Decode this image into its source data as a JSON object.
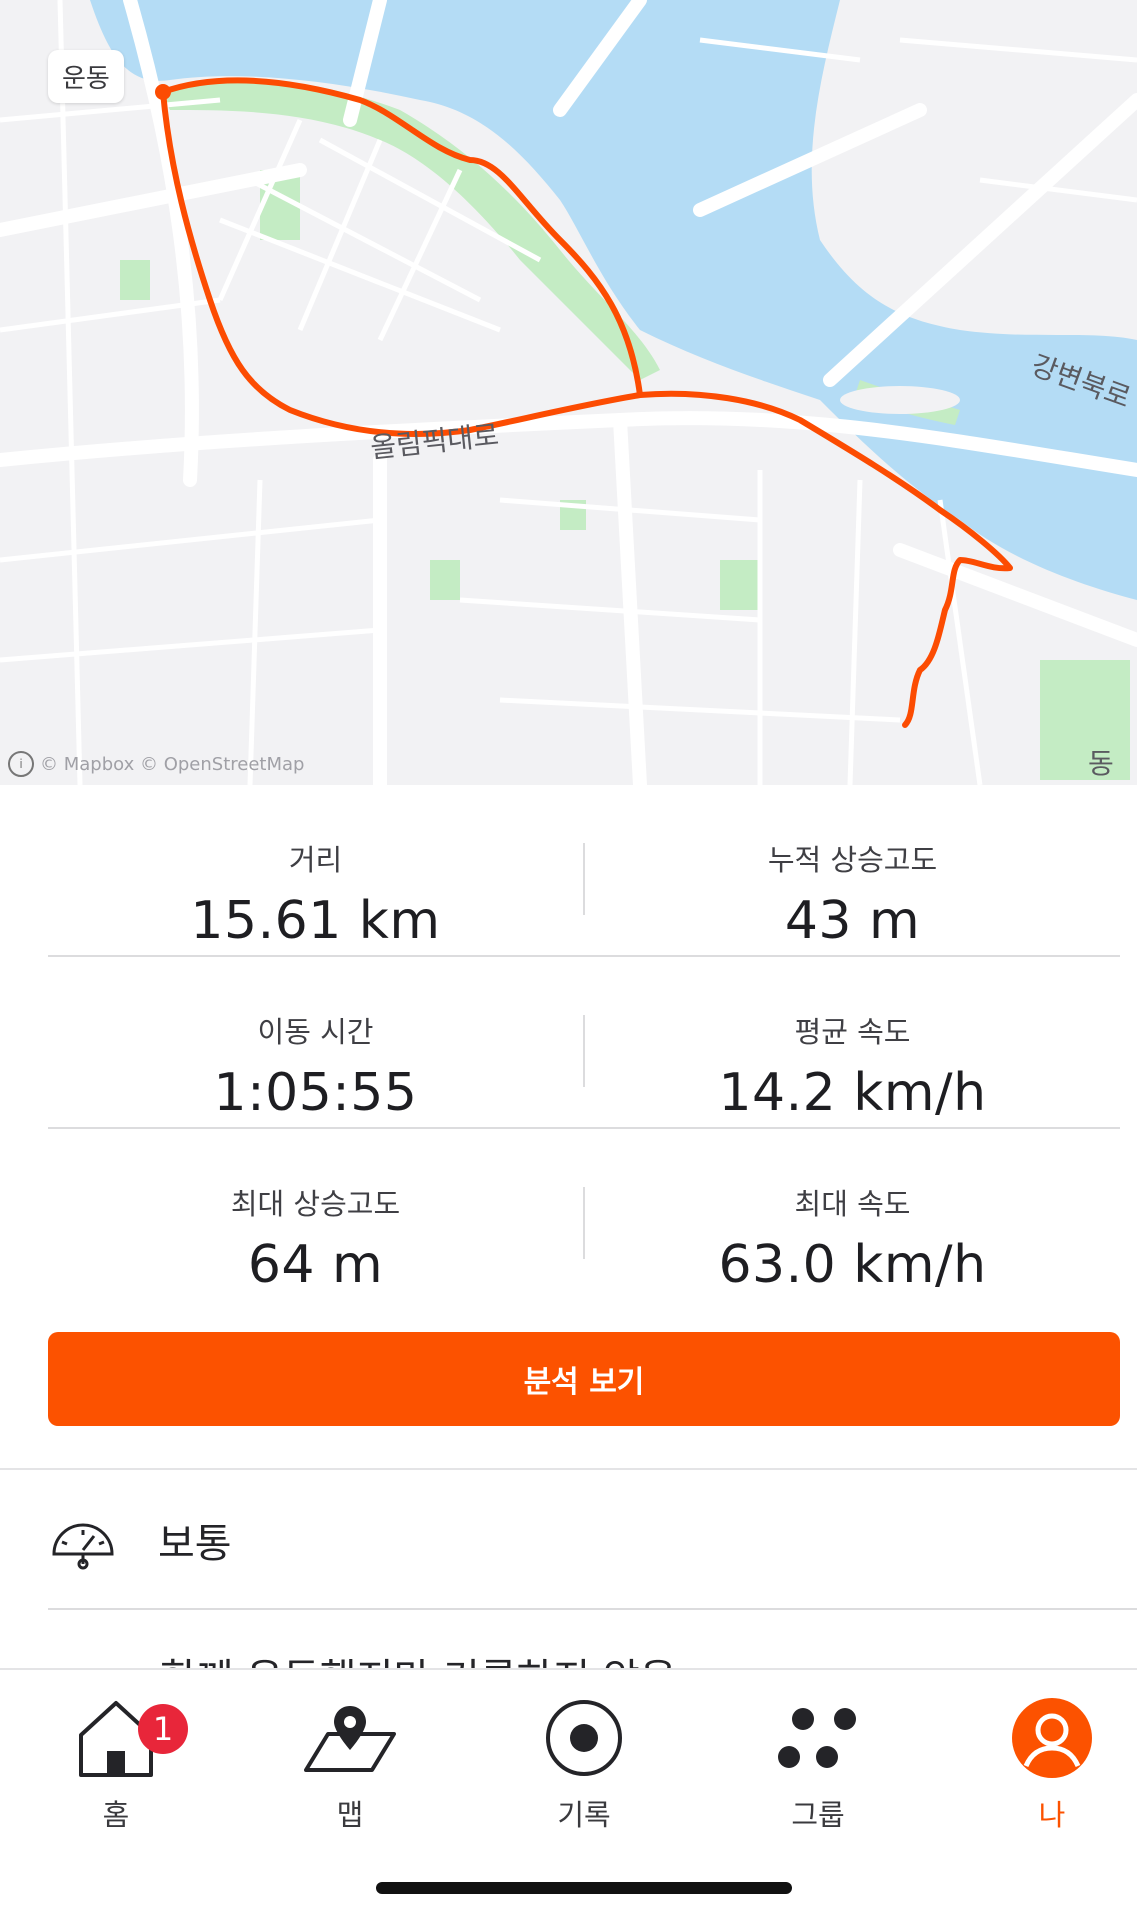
{
  "map": {
    "activity_chip": "운동",
    "road_label": "올림픽대로",
    "road_label_ne": "강변북로",
    "place_label_se": "동작",
    "attribution": "© Mapbox © OpenStreetMap",
    "colors": {
      "route": "#fc4c02",
      "water": "#b4dcf5",
      "park": "#c4ecc4",
      "land": "#f2f2f4"
    }
  },
  "stats": {
    "distance": {
      "label": "거리",
      "value": "15.61 km"
    },
    "elevation_gain": {
      "label": "누적 상승고도",
      "value": "43 m"
    },
    "moving_time": {
      "label": "이동 시간",
      "value": "1:05:55"
    },
    "avg_speed": {
      "label": "평균 속도",
      "value": "14.2 km/h"
    },
    "max_elevation": {
      "label": "최대 상승고도",
      "value": "64 m"
    },
    "max_speed": {
      "label": "최대 속도",
      "value": "63.0 km/h"
    }
  },
  "analyze_button": {
    "label": "분석 보기",
    "color": "#fc5200"
  },
  "effort": {
    "label": "보통",
    "icon": "gauge-icon"
  },
  "clipped_text": "함께 운동했지만 기록하지 않음",
  "tabbar": {
    "items": [
      {
        "label": "홈",
        "icon": "home-icon",
        "badge": "1"
      },
      {
        "label": "맵",
        "icon": "map-icon"
      },
      {
        "label": "기록",
        "icon": "record-icon"
      },
      {
        "label": "그룹",
        "icon": "groups-icon"
      },
      {
        "label": "나",
        "icon": "profile-icon",
        "active": true
      }
    ]
  }
}
